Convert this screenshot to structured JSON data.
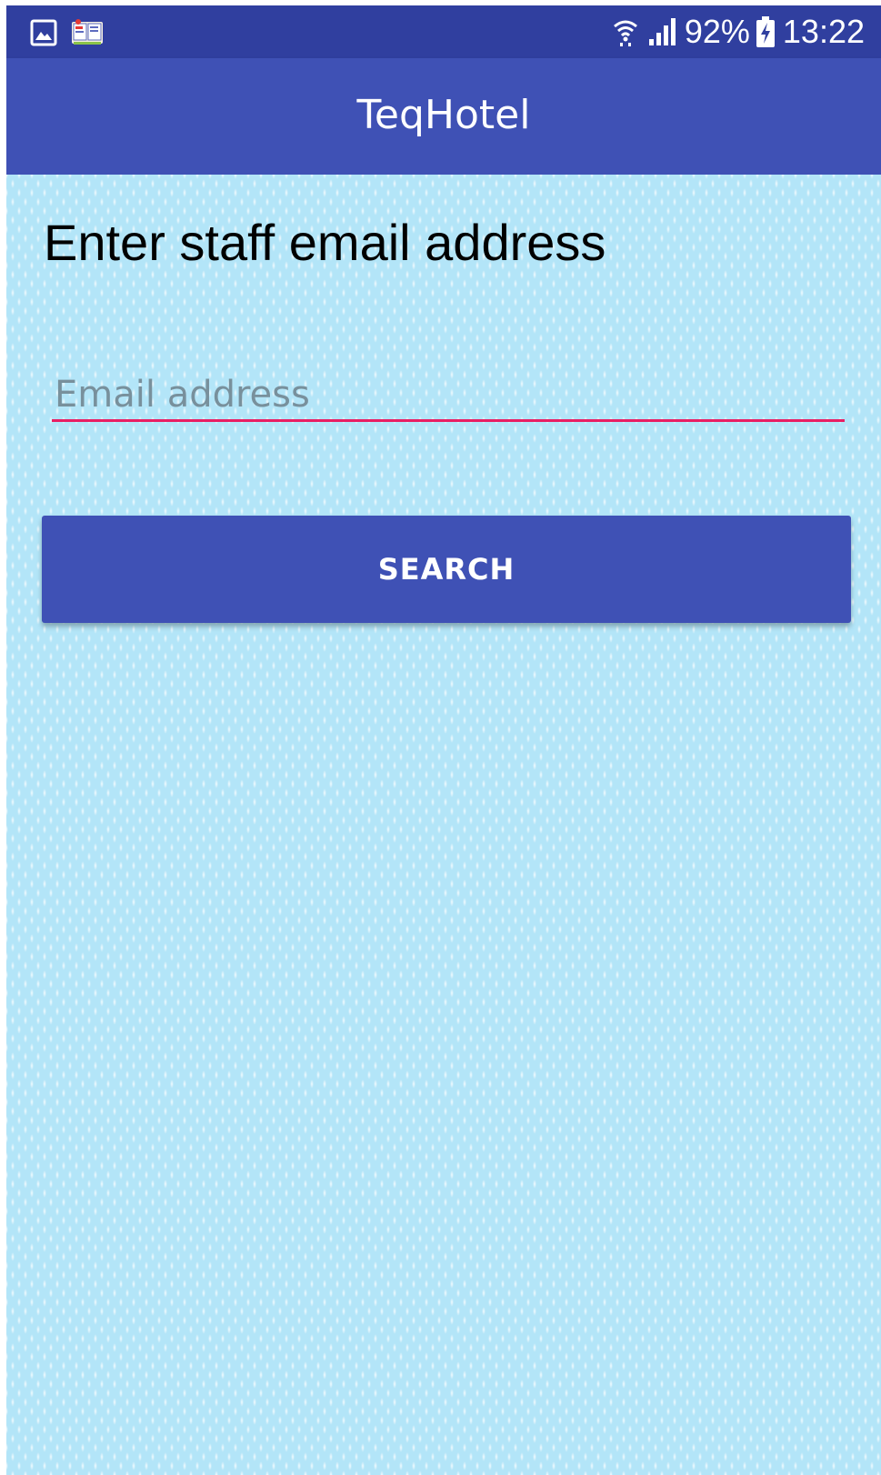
{
  "status_bar": {
    "battery_percent": "92%",
    "time": "13:22",
    "icons": [
      "gallery-notification-icon",
      "book-app-notification-icon",
      "wifi-icon",
      "signal-icon",
      "battery-charging-icon"
    ]
  },
  "toolbar": {
    "title": "TeqHotel"
  },
  "main": {
    "heading": "Enter staff email address",
    "email_field": {
      "value": "",
      "placeholder": "Email address"
    },
    "search_label": "SEARCH"
  },
  "colors": {
    "status_bar": "#303f9f",
    "primary": "#3f51b5",
    "accent": "#e91e63",
    "background": "#b3e5f8",
    "placeholder": "#78909c"
  }
}
